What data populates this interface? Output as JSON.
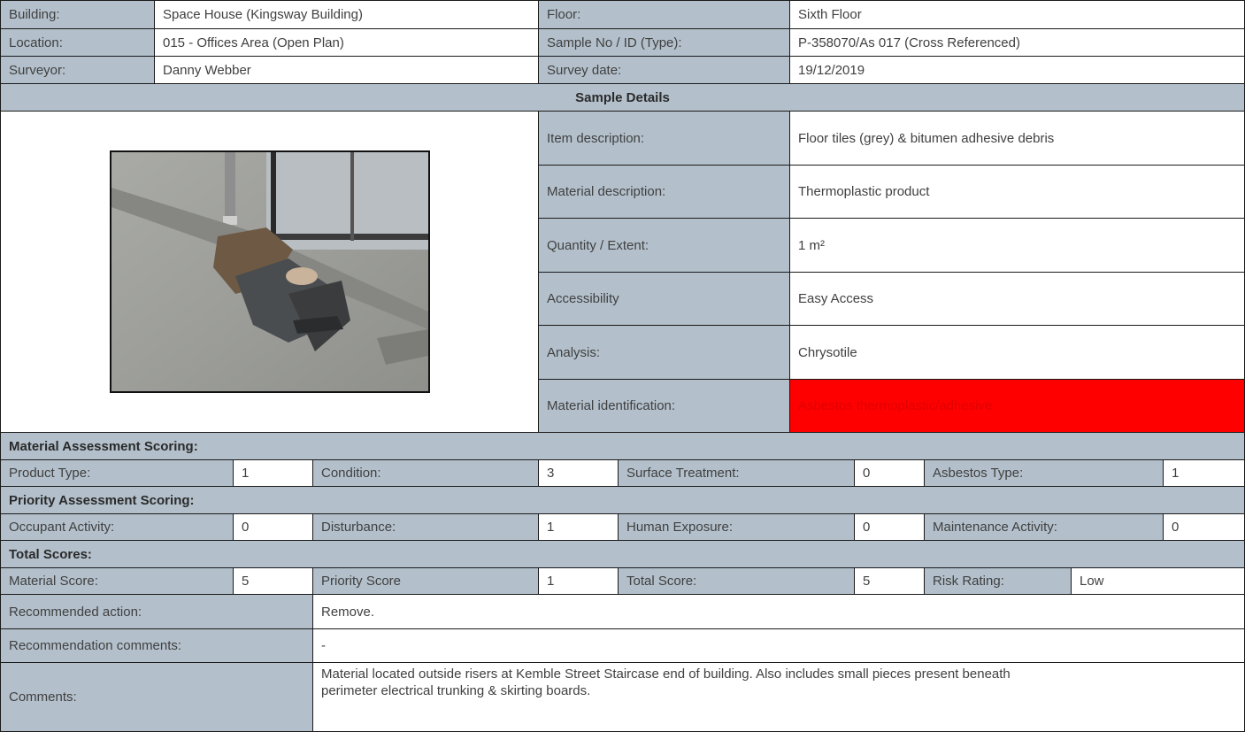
{
  "header": {
    "building_label": "Building:",
    "building_value": "Space House (Kingsway Building)",
    "floor_label": "Floor:",
    "floor_value": "Sixth Floor",
    "location_label": "Location:",
    "location_value": "015 - Offices Area (Open Plan)",
    "sample_label": "Sample No / ID (Type):",
    "sample_value": "P-358070/As 017 (Cross Referenced)",
    "surveyor_label": "Surveyor:",
    "surveyor_value": "Danny Webber",
    "date_label": "Survey date:",
    "date_value": "19/12/2019"
  },
  "sample_details": {
    "title": "Sample Details",
    "item_label": "Item description:",
    "item_value": "Floor tiles (grey) & bitumen adhesive debris",
    "material_label": "Material description:",
    "material_value": "Thermoplastic product",
    "quantity_label": "Quantity / Extent:",
    "quantity_value": "1 m²",
    "access_label": "Accessibility",
    "access_value": "Easy Access",
    "analysis_label": "Analysis:",
    "analysis_value": "Chrysotile",
    "identification_label": "Material identification:",
    "identification_value": "Asbestos thermoplastic/adhesive"
  },
  "material_assessment": {
    "title": "Material Assessment Scoring:",
    "product_type_label": "Product Type:",
    "product_type_value": "1",
    "condition_label": "Condition:",
    "condition_value": "3",
    "surface_label": "Surface Treatment:",
    "surface_value": "0",
    "asbestos_type_label": "Asbestos Type:",
    "asbestos_type_value": "1"
  },
  "priority_assessment": {
    "title": "Priority Assessment Scoring:",
    "occupant_label": "Occupant Activity:",
    "occupant_value": "0",
    "disturbance_label": "Disturbance:",
    "disturbance_value": "1",
    "exposure_label": "Human Exposure:",
    "exposure_value": "0",
    "maintenance_label": "Maintenance Activity:",
    "maintenance_value": "0"
  },
  "totals": {
    "title": "Total Scores:",
    "material_score_label": "Material Score:",
    "material_score_value": "5",
    "priority_score_label": "Priority Score",
    "priority_score_value": "1",
    "total_score_label": "Total Score:",
    "total_score_value": "5",
    "risk_label": "Risk Rating:",
    "risk_value": "Low"
  },
  "recommendations": {
    "action_label": "Recommended action:",
    "action_value": "Remove.",
    "comments_label": "Recommendation comments:",
    "comments_value": "-",
    "general_label": "Comments:",
    "general_value": "Material located outside risers at Kemble Street Staircase end of building. Also includes small pieces present beneath perimeter electrical trunking & skirting boards."
  },
  "colors": {
    "label_fill": "#b3c0cb",
    "alert_fill": "#ff0000"
  }
}
